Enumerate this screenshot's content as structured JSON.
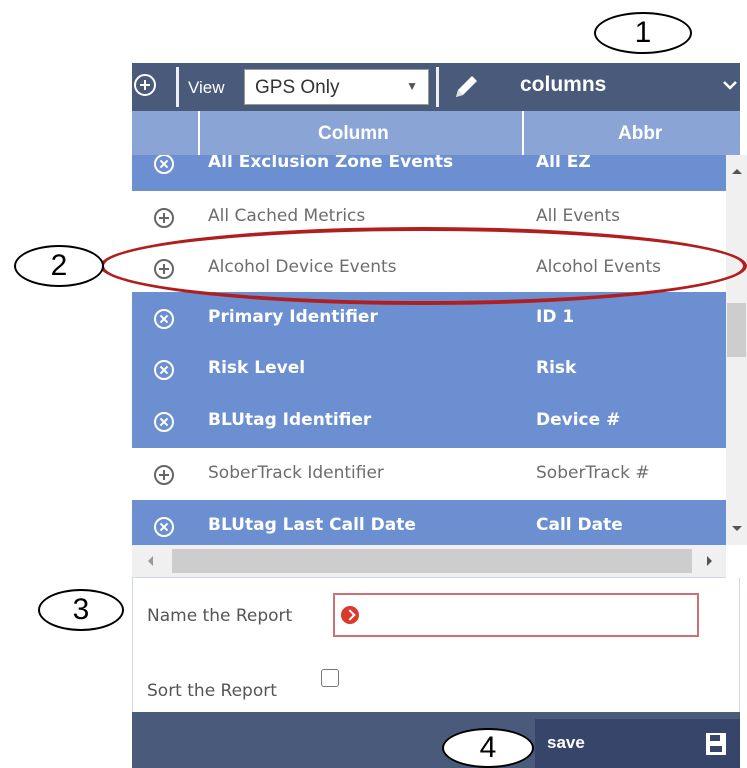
{
  "callouts": [
    "1",
    "2",
    "3",
    "4"
  ],
  "toolbar": {
    "add_icon": "plus-circle-icon",
    "view_label": "View",
    "view_select_value": "GPS Only",
    "edit_icon": "pencil-icon",
    "columns_label": "columns",
    "dropdown_icon": "chevron-down-icon"
  },
  "table": {
    "headers": {
      "column": "Column",
      "abbr": "Abbr"
    },
    "rows": [
      {
        "name": "All Exclusion Zone Events",
        "abbr": "All EZ",
        "selected": true
      },
      {
        "name": "All Cached Metrics",
        "abbr": "All Events",
        "selected": false
      },
      {
        "name": "Alcohol Device Events",
        "abbr": "Alcohol Events",
        "selected": false
      },
      {
        "name": "Primary Identifier",
        "abbr": "ID 1",
        "selected": true
      },
      {
        "name": "Risk Level",
        "abbr": "Risk",
        "selected": true
      },
      {
        "name": "BLUtag Identifier",
        "abbr": "Device #",
        "selected": true
      },
      {
        "name": "SoberTrack Identifier",
        "abbr": "SoberTrack #",
        "selected": false
      },
      {
        "name": "BLUtag Last Call Date",
        "abbr": "Call Date",
        "selected": true
      }
    ],
    "selected_color": "#6b8fd0",
    "unselected_color": "#ffffff"
  },
  "form": {
    "name_label": "Name the Report",
    "name_value": "",
    "sort_label": "Sort the Report",
    "sort_checked": false
  },
  "footer": {
    "save_label": "save",
    "save_icon": "floppy-disk-icon"
  },
  "colors": {
    "toolbar": "#4a5a7a",
    "header": "#8aa4d6",
    "highlight_ellipse": "#b01e1e"
  }
}
